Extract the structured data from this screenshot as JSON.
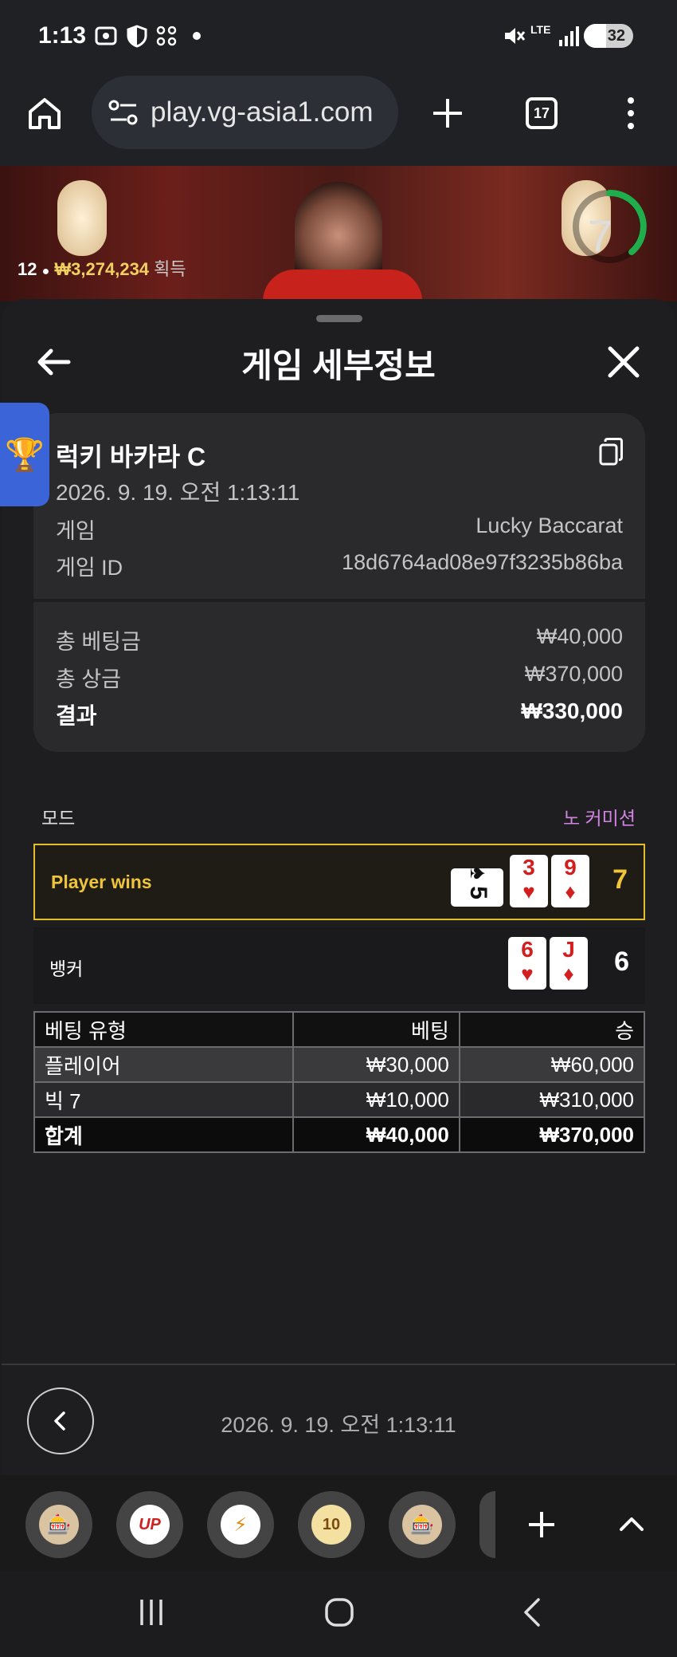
{
  "status_bar": {
    "time": "1:13",
    "battery": "32",
    "network": "LTE"
  },
  "browser": {
    "url": "play.vg-asia1.com",
    "tab_count": "17"
  },
  "video": {
    "winner_count": "12",
    "winnings_amount": "₩3,274,234",
    "winnings_label": "획득",
    "timer": "7"
  },
  "modal": {
    "title": "게임 세부정보"
  },
  "game_info": {
    "name": "럭키 바카라 C",
    "datetime": "2026. 9. 19. 오전 1:13:11",
    "rows": [
      {
        "label": "게임",
        "value": "Lucky Baccarat"
      },
      {
        "label": "게임 ID",
        "value": "18d6764ad08e97f3235b86ba"
      }
    ],
    "summary": [
      {
        "label": "총 베팅금",
        "value": "₩40,000"
      },
      {
        "label": "총 상금",
        "value": "₩370,000"
      },
      {
        "label": "결과",
        "value": "₩330,000"
      }
    ]
  },
  "mode": {
    "label": "모드",
    "value": "노 커미션"
  },
  "player_hand": {
    "label": "Player wins",
    "score": "7",
    "cards": [
      {
        "rank": "5",
        "suit": "♠",
        "color": "#111111"
      },
      {
        "rank": "3",
        "suit": "♥",
        "color": "#d21e1e"
      },
      {
        "rank": "9",
        "suit": "♦",
        "color": "#d21e1e"
      }
    ]
  },
  "banker_hand": {
    "label": "뱅커",
    "score": "6",
    "cards": [
      {
        "rank": "6",
        "suit": "♥",
        "color": "#d21e1e"
      },
      {
        "rank": "J",
        "suit": "♦",
        "color": "#d21e1e"
      }
    ]
  },
  "bets_table": {
    "headers": [
      "베팅 유형",
      "베팅",
      "승"
    ],
    "rows": [
      [
        "플레이어",
        "₩30,000",
        "₩60,000"
      ],
      [
        "빅 7",
        "₩10,000",
        "₩310,000"
      ]
    ],
    "total": [
      "합계",
      "₩40,000",
      "₩370,000"
    ]
  },
  "footer": {
    "datetime": "2026. 9. 19. 오전 1:13:11"
  },
  "dock": {
    "items": [
      {
        "name": "slot-machine-icon",
        "glyph": "🎰"
      },
      {
        "name": "up-game-icon",
        "glyph": "UP"
      },
      {
        "name": "lightning-game-icon",
        "glyph": "⚡"
      },
      {
        "name": "ten-game-icon",
        "glyph": "10"
      },
      {
        "name": "slot-machine-2-icon",
        "glyph": "🎰"
      }
    ]
  },
  "colors": {
    "accent_gold": "#f0c43a",
    "mode_purple": "#d184e0",
    "trophy_blue": "#3b64d8",
    "timer_green": "#1fae4b"
  }
}
